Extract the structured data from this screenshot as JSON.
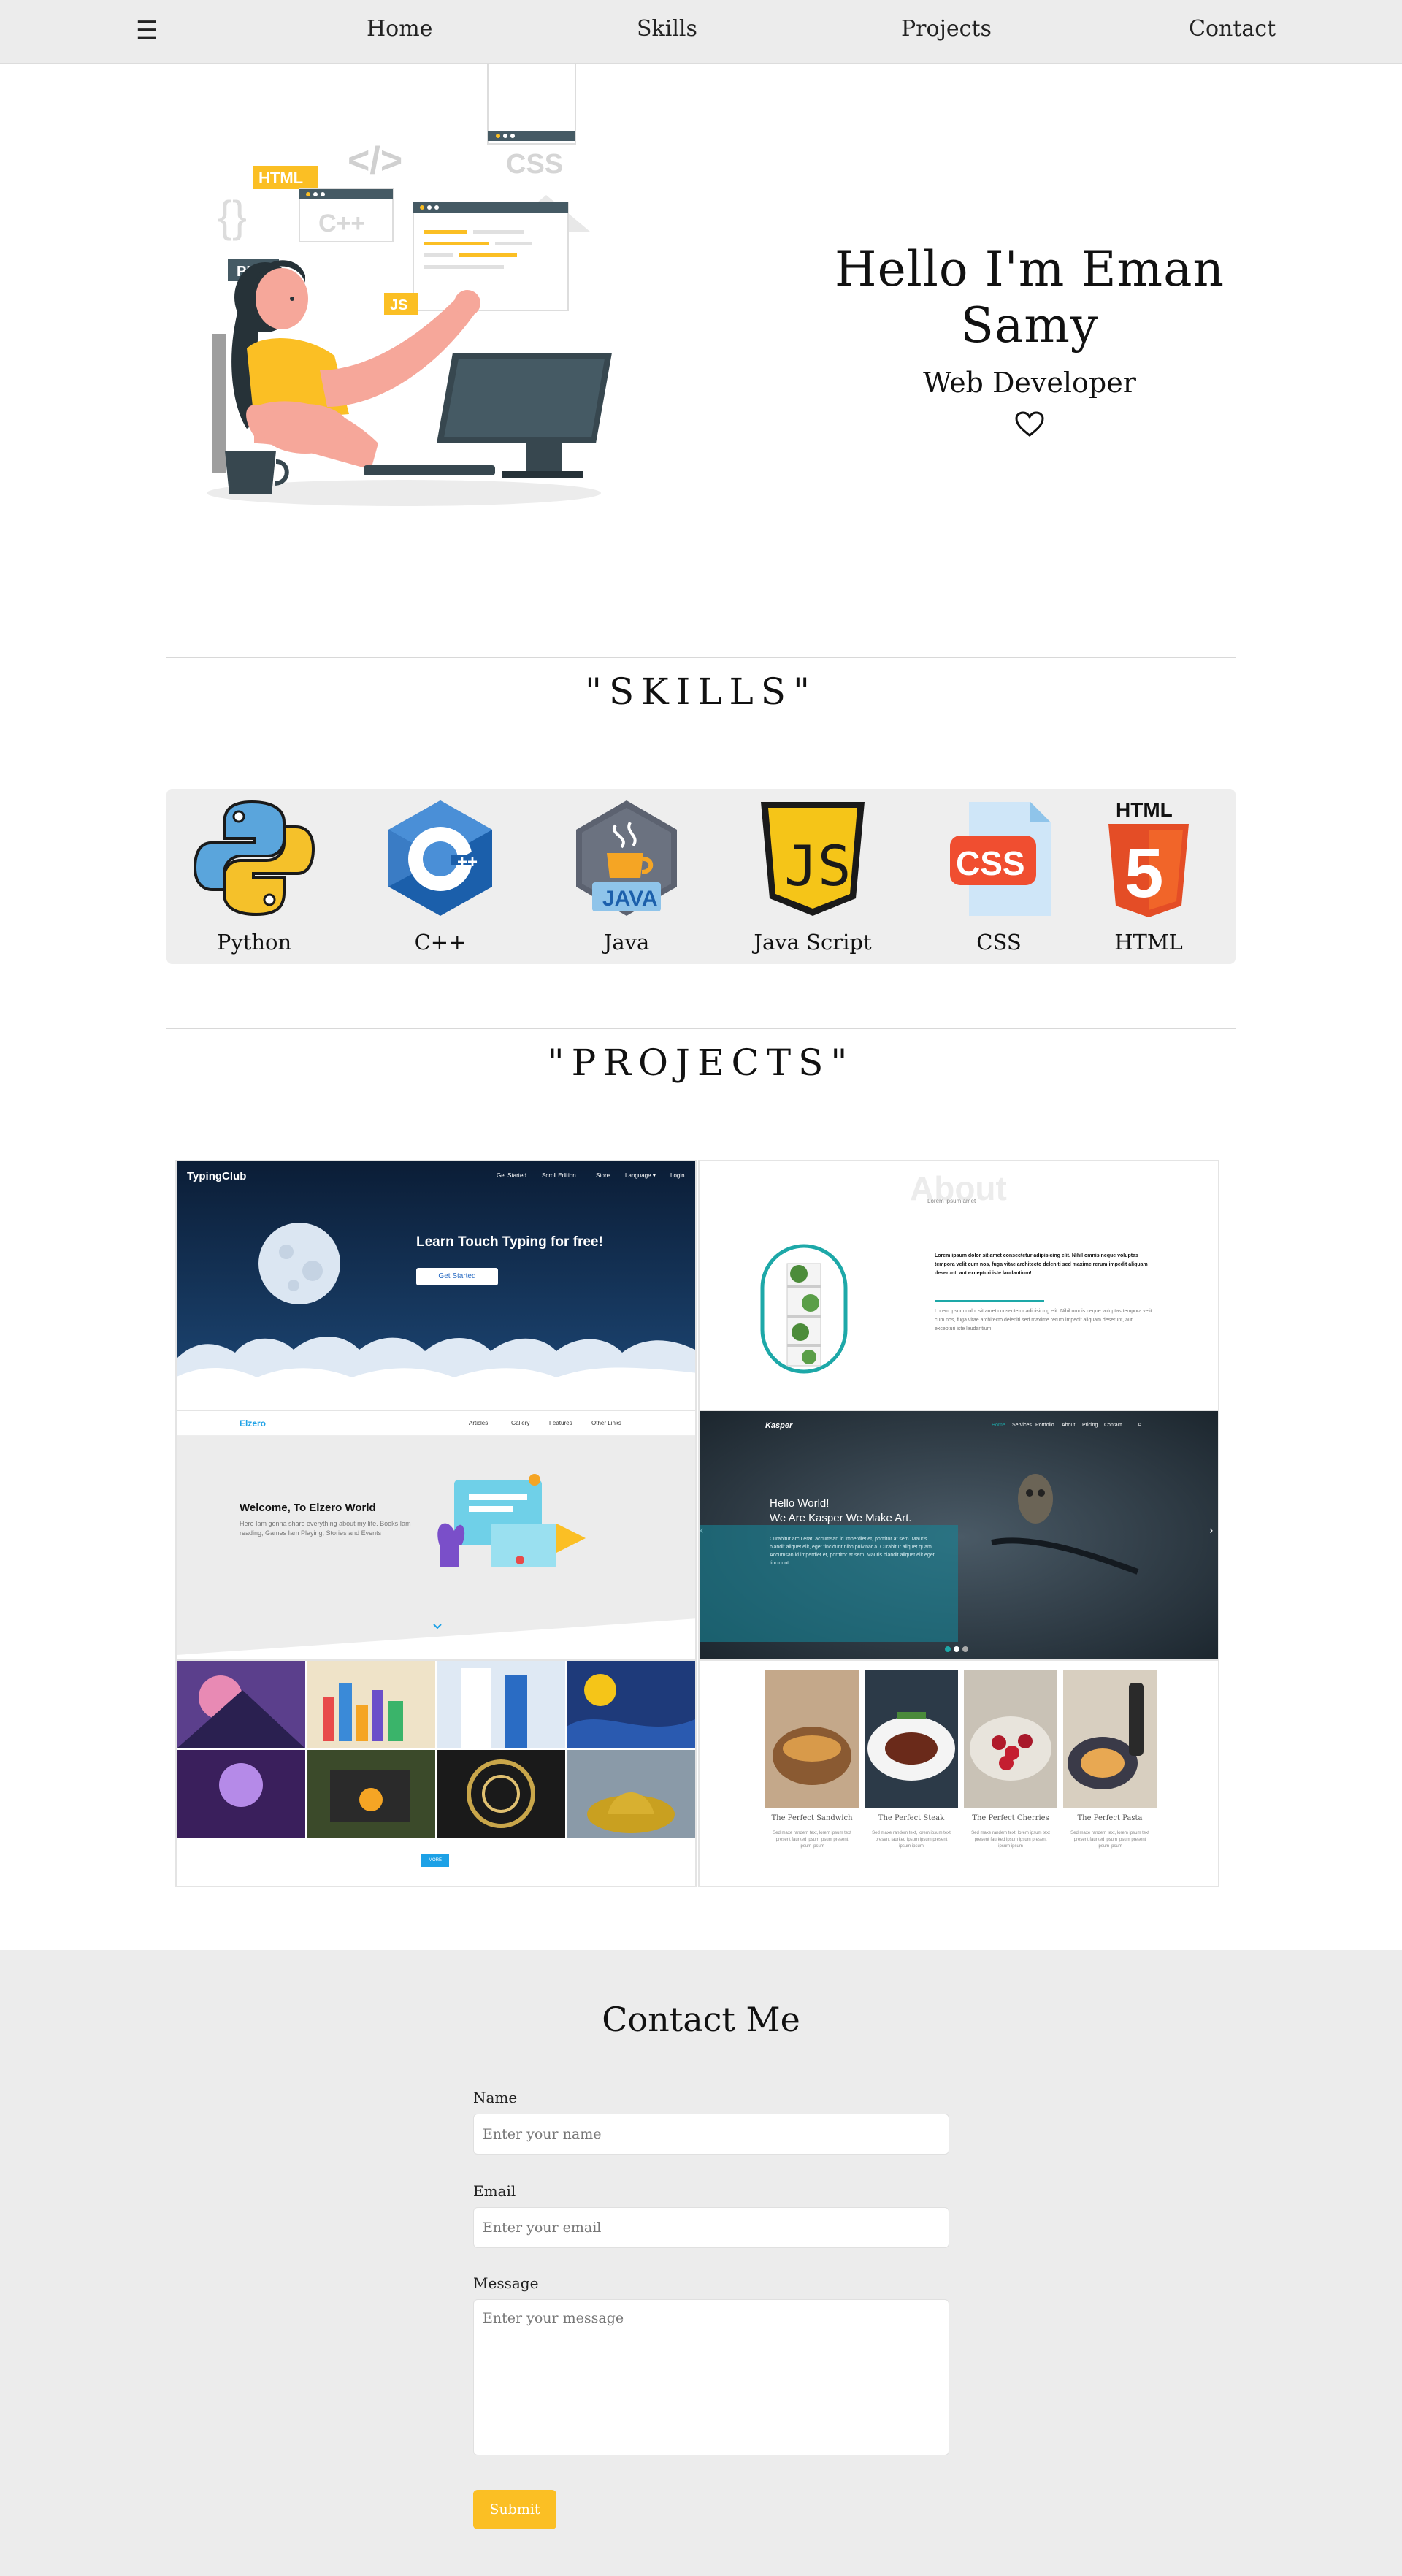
{
  "nav": {
    "menu_icon": "☰",
    "links": [
      {
        "label": "Home"
      },
      {
        "label": "Skills"
      },
      {
        "label": "Projects"
      },
      {
        "label": "Contact"
      }
    ]
  },
  "hero": {
    "title": "Hello I'm Eman Samy",
    "subtitle": "Web Developer",
    "icon": "heart-outline-icon",
    "illustration_tags": [
      "HTML",
      "CSS",
      "PHP",
      "JS",
      "</>",
      "{}",
      "C++"
    ]
  },
  "skills": {
    "title": "\"SKILLS\"",
    "items": [
      {
        "label": "Python",
        "icon": "python-icon"
      },
      {
        "label": "C++",
        "icon": "cplusplus-icon"
      },
      {
        "label": "Java",
        "icon": "java-icon",
        "badge": "JAVA"
      },
      {
        "label": "Java Script",
        "icon": "javascript-icon",
        "badge": "JS"
      },
      {
        "label": "CSS",
        "icon": "css-icon",
        "badge": "CSS"
      },
      {
        "label": "HTML",
        "icon": "html5-icon",
        "badge": "HTML",
        "number": "5"
      }
    ]
  },
  "projects": {
    "title": "\"PROJECTS\"",
    "typingclub": {
      "logo": "TypingClub",
      "nav": [
        "Get Started",
        "Scroll Edition",
        "Store",
        "Language ▾",
        "Login"
      ],
      "headline": "Learn Touch Typing for free!",
      "button": "Get Started"
    },
    "about": {
      "title": "About",
      "sub": "Lorem ipsum amet",
      "bold_text": "Lorem ipsum dolor sit amet consectetur adipisicing elit. Nihil omnis neque voluptas tempora velit cum nos, fuga vitae architecto deleniti sed maxime rerum impedit aliquam deserunt, aut excepturi iste laudantium!",
      "light_text": "Lorem ipsum dolor sit amet consectetur adipisicing elit. Nihil omnis neque voluptas tempora velit cum nos, fuga vitae architecto deleniti sed maxime rerum impedit aliquam deserunt, aut excepturi iste laudantium!"
    },
    "elzero": {
      "logo": "Elzero",
      "nav": [
        "Articles",
        "Gallery",
        "Features",
        "Other Links"
      ],
      "headline": "Welcome, To Elzero World",
      "text": "Here Iam gonna share everything about my life. Books Iam reading, Games Iam Playing, Stories and Events"
    },
    "kasper": {
      "logo": "Kasper",
      "nav": [
        "Home",
        "Services",
        "Portfolio",
        "About",
        "Pricing",
        "Contact"
      ],
      "headline1": "Hello World!",
      "headline2": "We Are Kasper We Make Art.",
      "text": "Curabitur arcu erat, accumsan id imperdiet et, porttitor at sem. Mauris blandit aliquet elit, eget tincidunt nibh pulvinar a. Curabitur aliquet quam. Accumsan id imperdiet et, porttitor at sem. Mauris blandit aliquet elit eget tincidunt."
    },
    "gallery": {
      "button": "MORE"
    },
    "food": {
      "items": [
        {
          "title": "The Perfect Sandwich",
          "text": "Sed maxe randem text, lorem ipsum text present faurked ipsum ipsum present ipsum ipsum"
        },
        {
          "title": "The Perfect Steak",
          "text": "Sed maxe randem text, lorem ipsum text present faurked ipsum ipsum present ipsum ipsum"
        },
        {
          "title": "The Perfect Cherries",
          "text": "Sed maxe randem text, lorem ipsum text present faurked ipsum ipsum present ipsum ipsum"
        },
        {
          "title": "The Perfect Pasta",
          "text": "Sed maxe randem text, lorem ipsum text present faurked ipsum ipsum present ipsum ipsum"
        }
      ]
    }
  },
  "contact": {
    "title": "Contact Me",
    "name_label": "Name",
    "name_placeholder": "Enter your name",
    "email_label": "Email",
    "email_placeholder": "Enter your email",
    "message_label": "Message",
    "message_placeholder": "Enter your message",
    "submit_label": "Submit"
  },
  "colors": {
    "accent": "#fbbf24",
    "nav_bg": "#ececec",
    "section_bg": "#eeeeee",
    "teal": "#1da8a8"
  }
}
